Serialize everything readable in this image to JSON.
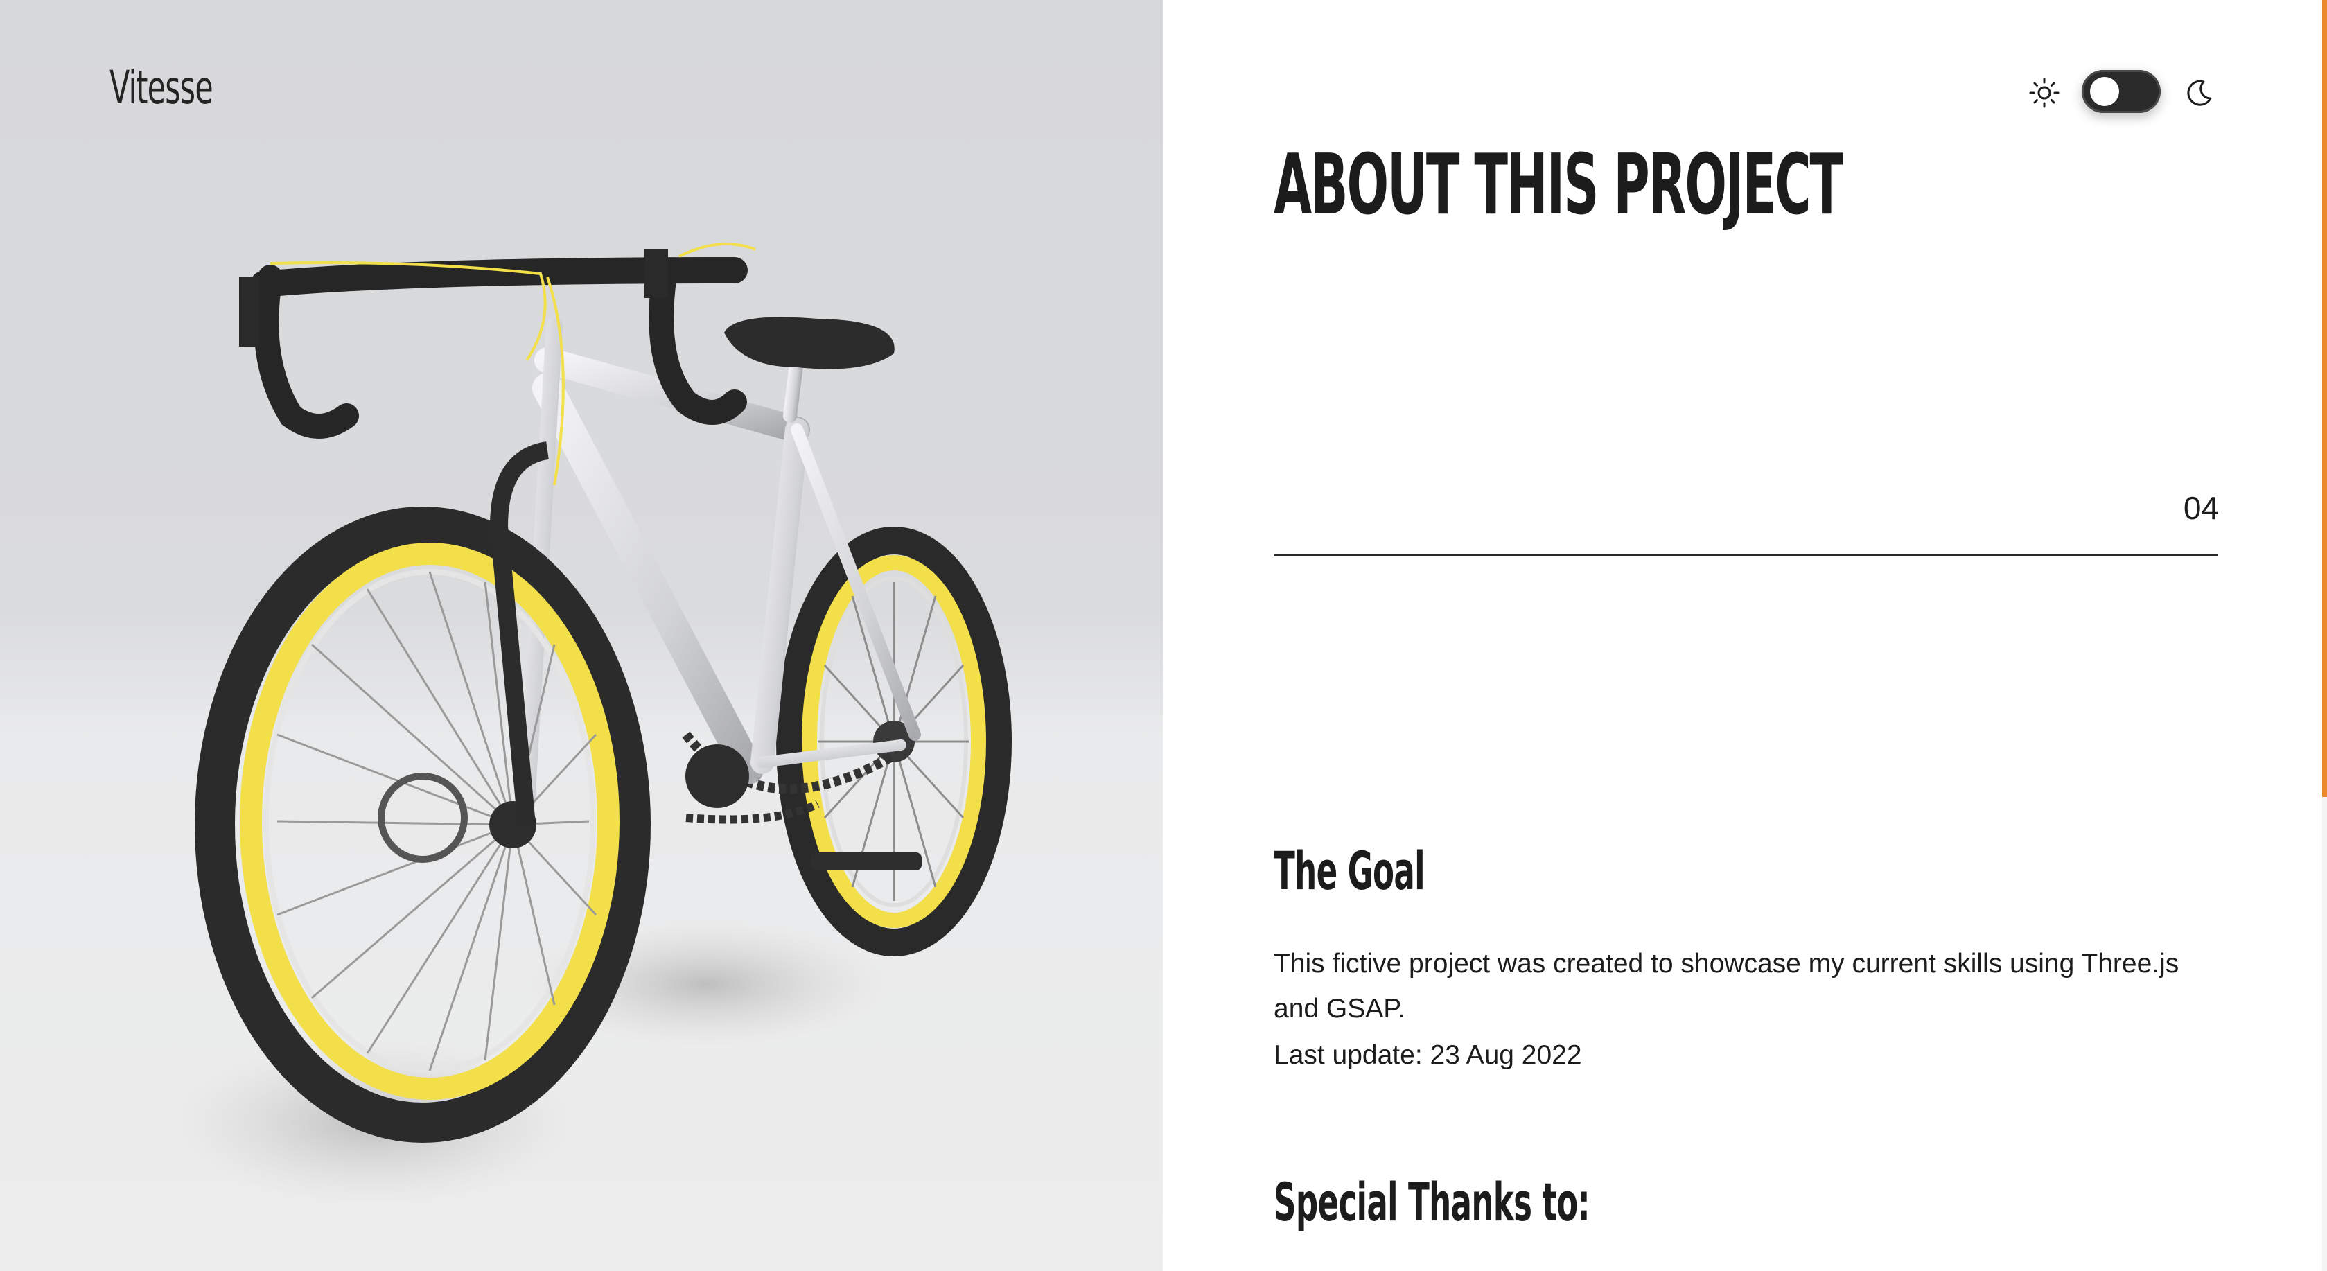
{
  "brand": {
    "name": "Vitesse"
  },
  "theme": {
    "mode": "light",
    "sun_icon": "sun-icon",
    "moon_icon": "moon-icon"
  },
  "about": {
    "title": "ABOUT THIS PROJECT",
    "counter": "04"
  },
  "goal": {
    "heading": "The Goal",
    "text": "This fictive project was created to showcase my current skills using Three.js and GSAP.",
    "last_update": "Last update: 23 Aug 2022"
  },
  "thanks": {
    "heading": "Special Thanks to:"
  },
  "colors": {
    "accent": "#e8892a",
    "rim_yellow": "#f2df4a",
    "frame_silver": "#d9d9dc",
    "text": "#1c1c1c",
    "scene_bg": "#dadbdd"
  }
}
